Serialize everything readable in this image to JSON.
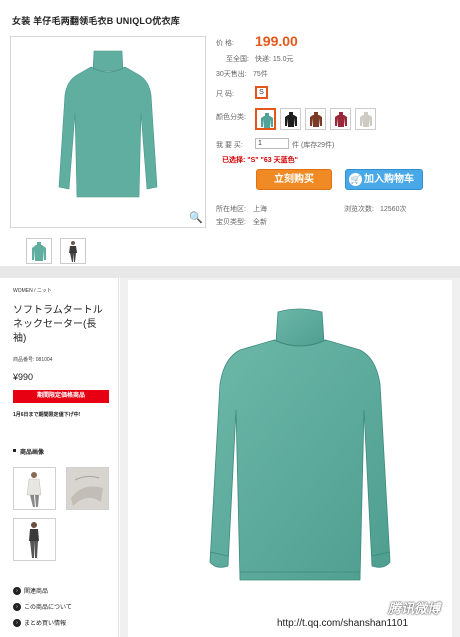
{
  "taobao": {
    "title": "女装 羊仔毛两翻领毛衣B UNIQLO优衣库",
    "price_label": "价  格:",
    "price": "199.00",
    "shipping_label": "至全国:",
    "shipping_value": "快递: 15.0元",
    "sold_label": "30天售出:",
    "sold_value": "75件",
    "size_label": "尺  码:",
    "size_value": "S",
    "color_label": "颜色分类:",
    "quantity_label": "我 要 买:",
    "quantity_value": "1",
    "quantity_unit": "件 (库存29件)",
    "selected_text": "已选择: \"S\" \"63 天蓝色\"",
    "buy_label": "立刻购买",
    "cart_label": "加入购物车",
    "location_label": "所在地区:",
    "location_value": "上海",
    "views_label": "浏览次数:",
    "views_value": "12560次",
    "type_label": "宝贝类型:",
    "type_value": "全新",
    "colors": [
      "#4fa398",
      "#1e1e1e",
      "#7a3a24",
      "#9a2a3a",
      "#cfcac2"
    ]
  },
  "uniqlo": {
    "breadcrumb": "WOMEN / ニット",
    "product_name": "ソフトラムタートルネックセーター(長袖)",
    "product_number_label": "商品番号:",
    "product_number": "081004",
    "price": "¥990",
    "limited_badge": "期間限定価格商品",
    "sale_note": "1月6日まで期間限定値下げ中!",
    "images_heading": "商品画像",
    "links": [
      "関連商品",
      "この商品について",
      "まとめ買い情報"
    ]
  },
  "watermark": {
    "logo": "腾讯微博",
    "url": "http://t.qq.com/shanshan1101"
  },
  "colors": {
    "accent_orange": "#e4571b",
    "buy_button": "#f08a24",
    "cart_button": "#49a8e8",
    "sale_red": "#e60012",
    "sweater": "#5fae9f"
  }
}
